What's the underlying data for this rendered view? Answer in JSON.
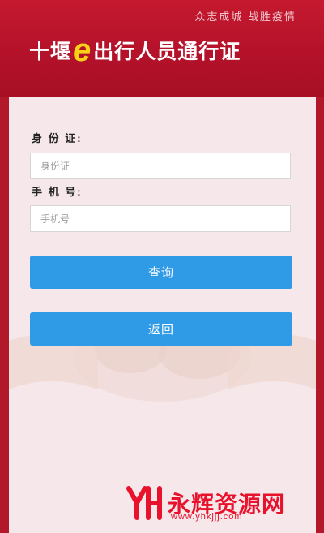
{
  "header": {
    "slogan": "众志成城 战胜疫情",
    "title_prefix": "十堰",
    "title_e": "e",
    "title_suffix": "出行人员通行证"
  },
  "form": {
    "id_label": "身 份 证:",
    "id_placeholder": "身份证",
    "phone_label": "手 机 号:",
    "phone_placeholder": "手机号",
    "query_button": "查询",
    "back_button": "返回"
  },
  "watermark": {
    "name": "永辉资源网",
    "url": "www.yhkjjj.com"
  },
  "colors": {
    "header_red": "#b4122a",
    "panel_bg": "#f6e7ea",
    "button_blue": "#2f9ae6",
    "title_e_yellow": "#f7d117",
    "watermark_red": "#e8122c"
  }
}
